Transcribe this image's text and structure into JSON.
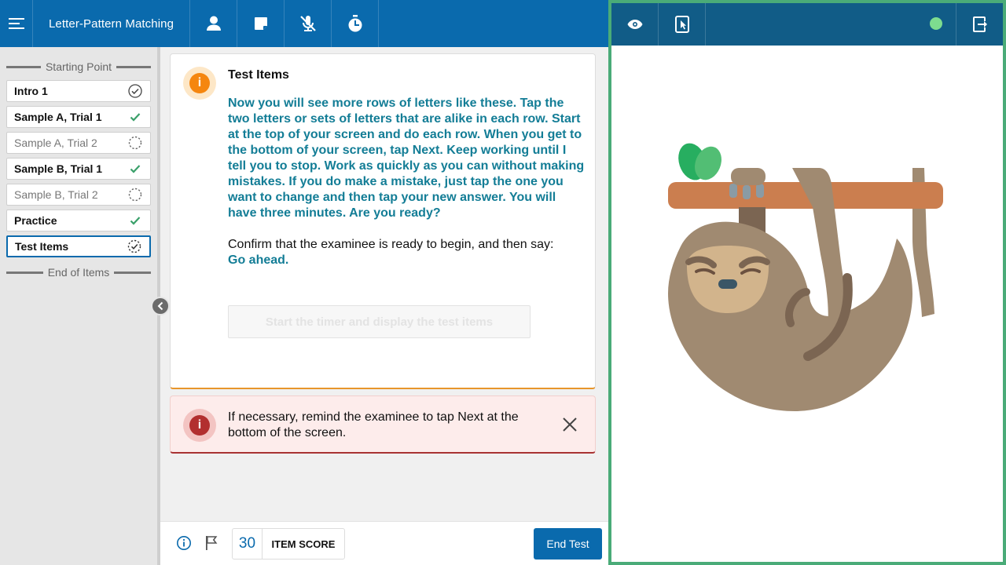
{
  "header": {
    "title": "Letter-Pattern Matching",
    "icons": [
      "menu-icon",
      "person-icon",
      "note-icon",
      "mic-off-icon",
      "stopwatch-icon"
    ]
  },
  "sidebar": {
    "start_label": "Starting Point",
    "end_label": "End of Items",
    "items": [
      {
        "label": "Intro 1",
        "status": "visited"
      },
      {
        "label": "Sample A, Trial 1",
        "status": "complete"
      },
      {
        "label": "Sample A, Trial 2",
        "status": "not-started"
      },
      {
        "label": "Sample B, Trial 1",
        "status": "complete"
      },
      {
        "label": "Sample B, Trial 2",
        "status": "not-started"
      },
      {
        "label": "Practice",
        "status": "complete"
      },
      {
        "label": "Test Items",
        "status": "current"
      }
    ]
  },
  "card": {
    "title": "Test Items",
    "say_text": "Now you will see more rows of letters like these. Tap the two letters or sets of letters that are alike in each row. Start at the top of your screen and do each row. When you get to the bottom of your screen, tap Next. Keep working until I tell you to stop. Work as quickly as you can without making mistakes. If you do make a mistake, just tap the one you want to change and then tap your new answer. You will have three minutes. Are you ready?",
    "confirm_text": "Confirm that the examinee is ready to begin, and then say:",
    "confirm_say": "Go ahead.",
    "start_button": "Start the timer and display the test items"
  },
  "alert": {
    "text": "If necessary, remind the examinee to tap Next at the bottom of the screen."
  },
  "footer": {
    "score_value": "30",
    "score_label": "ITEM SCORE",
    "end_button": "End Test"
  },
  "right_panel": {
    "status_color": "#7ddc8f",
    "icons": [
      "eye-icon",
      "tablet-pointer-icon",
      "exit-icon"
    ],
    "illustration": "sloth"
  },
  "colors": {
    "primary": "#0a6aad",
    "right_bar": "#115c87",
    "accent_text": "#137d96",
    "warning": "#f5860f",
    "error": "#b22f2f",
    "frame": "#4aab78"
  }
}
